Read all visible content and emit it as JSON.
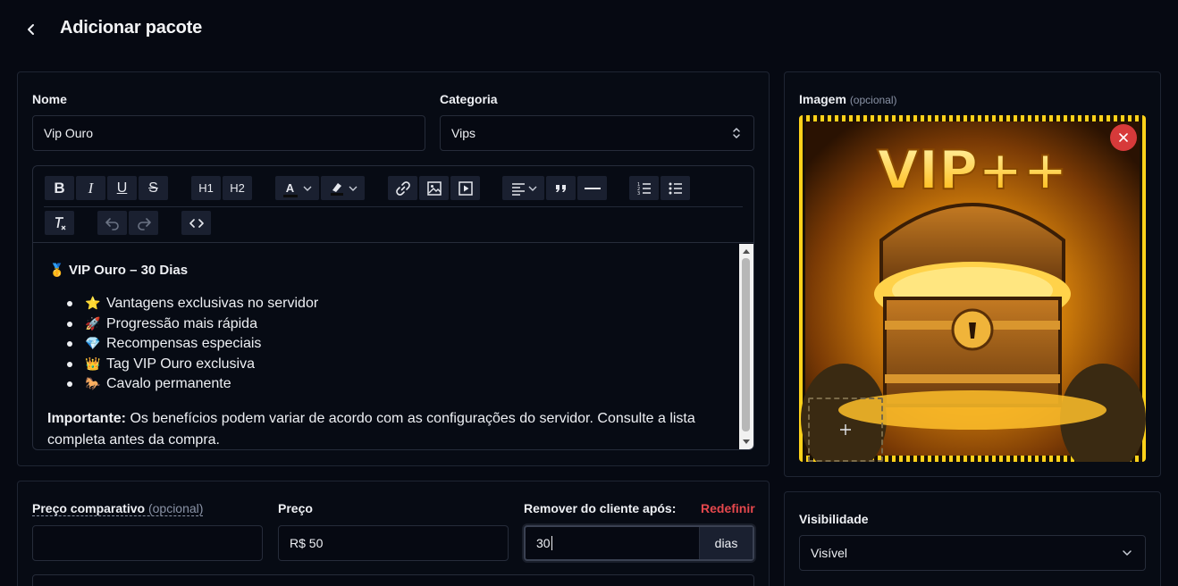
{
  "header": {
    "title": "Adicionar pacote"
  },
  "details": {
    "name_label": "Nome",
    "name_value": "Vip Ouro",
    "category_label": "Categoria",
    "category_value": "Vips"
  },
  "toolbar": {
    "bold": "B",
    "italic": "I",
    "underline": "U",
    "strike": "S",
    "h1": "H1",
    "h2": "H2",
    "text_color": "A"
  },
  "editor": {
    "heading_emoji": "🥇",
    "heading": "VIP Ouro – 30 Dias",
    "items": [
      {
        "emoji": "⭐",
        "text": "Vantagens exclusivas no servidor"
      },
      {
        "emoji": "🚀",
        "text": "Progressão mais rápida"
      },
      {
        "emoji": "💎",
        "text": "Recompensas especiais"
      },
      {
        "emoji": "👑",
        "text": "Tag VIP Ouro exclusiva"
      },
      {
        "emoji": "🐎",
        "text": "Cavalo permanente"
      }
    ],
    "note_bold": "Importante:",
    "note_text": " Os benefícios podem variar de acordo com as configurações do servidor. Consulte a lista completa antes da compra."
  },
  "image": {
    "label": "Imagem",
    "optional": "(opcional)",
    "banner_text": "VIP++"
  },
  "pricing": {
    "compare_label": "Preço comparativo",
    "compare_optional": "(opcional)",
    "compare_value": "",
    "price_label": "Preço",
    "price_value": "R$ 50",
    "remove_label": "Remover do cliente após:",
    "reset_label": "Redefinir",
    "remove_value": "30",
    "remove_unit": "dias"
  },
  "visibility": {
    "label": "Visibilidade",
    "value": "Visível"
  },
  "colors": {
    "accent_red": "#e5484d",
    "background": "#060912",
    "border": "#1f2533"
  }
}
